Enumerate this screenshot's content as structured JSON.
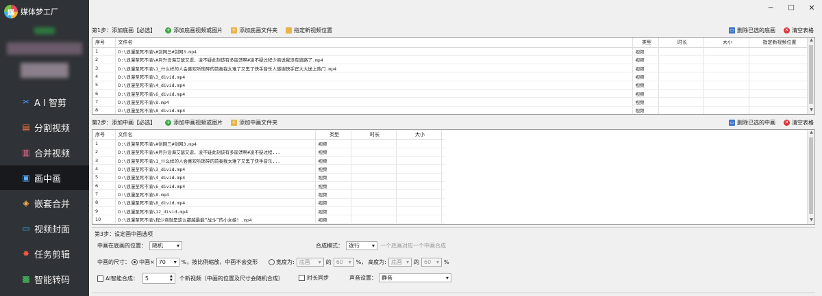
{
  "app": {
    "name": "媒体梦工厂",
    "logo_glyph": "媒"
  },
  "window_buttons": {
    "minimize": "─",
    "maximize": "☐",
    "close": "✕"
  },
  "sidebar": {
    "items": [
      {
        "label": "A I 智剪",
        "icon": "ai-cut-icon",
        "glyph": "✂",
        "color": "#4fa3ff"
      },
      {
        "label": "分割视频",
        "icon": "split-video-icon",
        "glyph": "▤",
        "color": "#ff7a45"
      },
      {
        "label": "合并视频",
        "icon": "merge-video-icon",
        "glyph": "▥",
        "color": "#ff6f9a"
      },
      {
        "label": "画中画",
        "icon": "picture-in-picture-icon",
        "glyph": "▣",
        "color": "#5ab0ff"
      },
      {
        "label": "嵌套合并",
        "icon": "nest-merge-icon",
        "glyph": "◈",
        "color": "#ffb84d"
      },
      {
        "label": "视频封面",
        "icon": "video-cover-icon",
        "glyph": "▭",
        "color": "#39c0ff"
      },
      {
        "label": "任务剪辑",
        "icon": "task-edit-icon",
        "glyph": "✸",
        "color": "#ff5a3c"
      },
      {
        "label": "智能转码",
        "icon": "smart-transcode-icon",
        "glyph": "▩",
        "color": "#4cd964"
      }
    ],
    "active_index": 3
  },
  "step1": {
    "title": "第1步：添加底画【必选】",
    "add_video_label": "添加底画视频或图片",
    "add_folder_label": "添加底画文件夹",
    "set_location_label": "指定新视频位置",
    "delete_selected_label": "删除已选的底画",
    "clear_table_label": "清空表格",
    "columns": [
      "序号",
      "文件名",
      "类型",
      "时长",
      "大小",
      "指定新视频位置"
    ],
    "rows": [
      [
        "1",
        "D:\\浪漫至死不渝\\#剑网三#剑网3.mp4",
        "视频"
      ],
      [
        "2",
        "D:\\浪漫至死不渝\\#月升沧海艾瑟又虐，凌不疑此刻该有多崩溃啊#凌不疑过程少商说我没有遮路了.mp4",
        "视频"
      ],
      [
        "3",
        "D:\\浪漫至死不渝\\1_什么样的人会喜欢听琐碎的前奏我太难了又黑了快手音乐人感谢快手官大大送上热门.mp4",
        "视频"
      ],
      [
        "4",
        "D:\\浪漫至死不渝\\3_divid.mp4",
        "视频"
      ],
      [
        "5",
        "D:\\浪漫至死不渝\\4_divid.mp4",
        "视频"
      ],
      [
        "6",
        "D:\\浪漫至死不渝\\6_divid.mp4",
        "视频"
      ],
      [
        "7",
        "D:\\浪漫至死不渝\\8.mp4",
        "视频"
      ],
      [
        "8",
        "D:\\浪漫至死不渝\\8_divid.mp4",
        "视频"
      ]
    ]
  },
  "step2": {
    "title": "第2步：添加中画【必选】",
    "add_video_label": "添加中画视频或图片",
    "add_folder_label": "添加中画文件夹",
    "delete_selected_label": "删除已选的中画",
    "clear_table_label": "清空表格",
    "columns": [
      "序号",
      "文件名",
      "类型",
      "时长",
      "大小"
    ],
    "rows": [
      [
        "1",
        "D:\\浪漫至死不渝\\#剑网三#剑网3.mp4",
        "视频"
      ],
      [
        "2",
        "D:\\浪漫至死不渝\\#月升沧海艾瑟又虐，凌不疑此刻该有多崩溃啊#凌不疑过程...",
        "视频"
      ],
      [
        "3",
        "D:\\浪漫至死不渝\\1_什么样的人会喜欢听琐碎的前奏我太难了又黑了快手音乐...",
        "视频"
      ],
      [
        "4",
        "D:\\浪漫至死不渝\\3_divid.mp4",
        "视频"
      ],
      [
        "5",
        "D:\\浪漫至死不渝\\4_divid.mp4",
        "视频"
      ],
      [
        "6",
        "D:\\浪漫至死不渝\\6_divid.mp4",
        "视频"
      ],
      [
        "7",
        "D:\\浪漫至死不渝\\8.mp4",
        "视频"
      ],
      [
        "8",
        "D:\\浪漫至死不渝\\8_divid.mp4",
        "视频"
      ],
      [
        "9",
        "D:\\浪漫至死不渝\\12_divid.mp4",
        "视频"
      ],
      [
        "10",
        "D:\\浪漫至死不渝\\程少商就是这么都越最能“战斗”的小女娘！.mp4",
        "视频"
      ]
    ]
  },
  "step3": {
    "title": "第3步：设定画中画选项",
    "position_label": "中画在底画的位置：",
    "position_value": "随机",
    "compose_mode_label": "合成模式：",
    "compose_mode_value": "逐行",
    "compose_mode_hint": "一个底画对应一个中画合成",
    "size_label": "中画的尺寸：",
    "scale_option_label": "中画×",
    "scale_value": "70",
    "scale_suffix": "%，按比例缩放，中画不会变形",
    "width_option_label": "宽度为:",
    "width_base": "底画",
    "of_label": "的",
    "width_pct": "60",
    "pct_label": "%，",
    "height_label": "高度为:",
    "height_base": "底画",
    "height_pct": "60",
    "height_pct_suffix": "%",
    "ai_compose_label": "AI智能合成：",
    "ai_count": "5",
    "ai_suffix": "个新视频（中画的位置及尺寸会随机合成）",
    "duration_sync_label": "时长同步",
    "audio_label": "声音设置：",
    "audio_value": "静音"
  }
}
